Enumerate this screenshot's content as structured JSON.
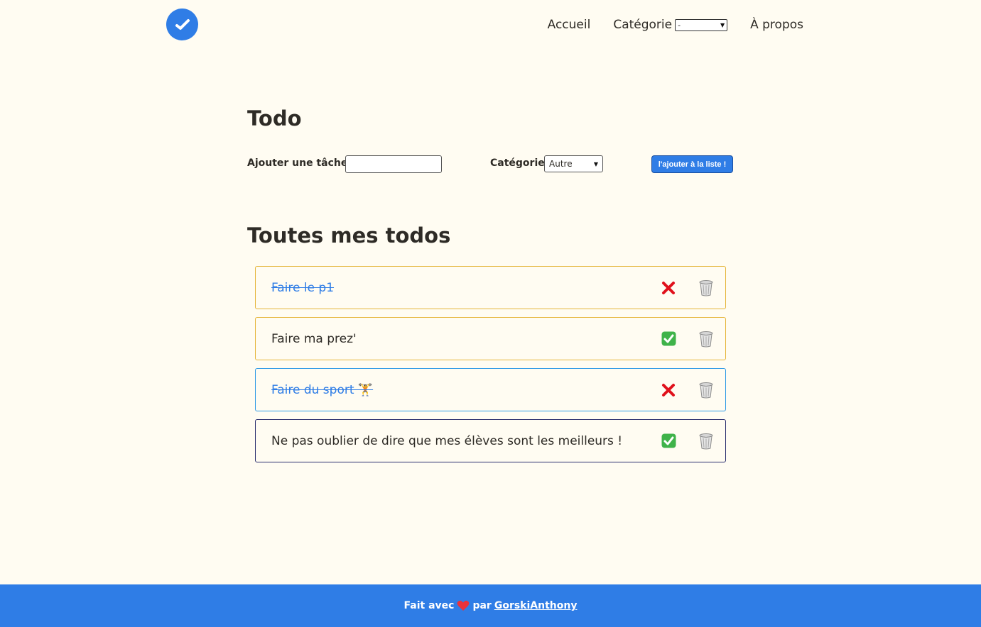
{
  "nav": {
    "home": "Accueil",
    "category_label": "Catégorie",
    "category_selected": "-",
    "about": "À propos"
  },
  "main": {
    "title": "Todo",
    "add_task_label": "Ajouter une tâche",
    "add_task_value": "",
    "category_label": "Catégorie",
    "category_selected": "Autre",
    "add_button": "l'ajouter à la liste !",
    "list_title": "Toutes mes todos"
  },
  "todos": [
    {
      "text": "Faire le p1",
      "done": true,
      "status_icon": "cross-mark-icon"
    },
    {
      "text": "Faire ma prez'",
      "done": false,
      "status_icon": "check-mark-icon"
    },
    {
      "text": "Faire du sport 🏋️",
      "done": true,
      "status_icon": "cross-mark-icon"
    },
    {
      "text": "Ne pas oublier de dire que mes élèves sont les meilleurs !",
      "done": false,
      "status_icon": "check-mark-icon"
    }
  ],
  "footer": {
    "prefix": "Fait avec",
    "middle": "par",
    "author": "GorskiAnthony"
  },
  "colors": {
    "background": "#fffcf2",
    "accent": "#2f7de6",
    "border_yellow": "#e5b53a",
    "border_blue": "#2f9ae6",
    "border_navy": "#2a2e6e"
  }
}
